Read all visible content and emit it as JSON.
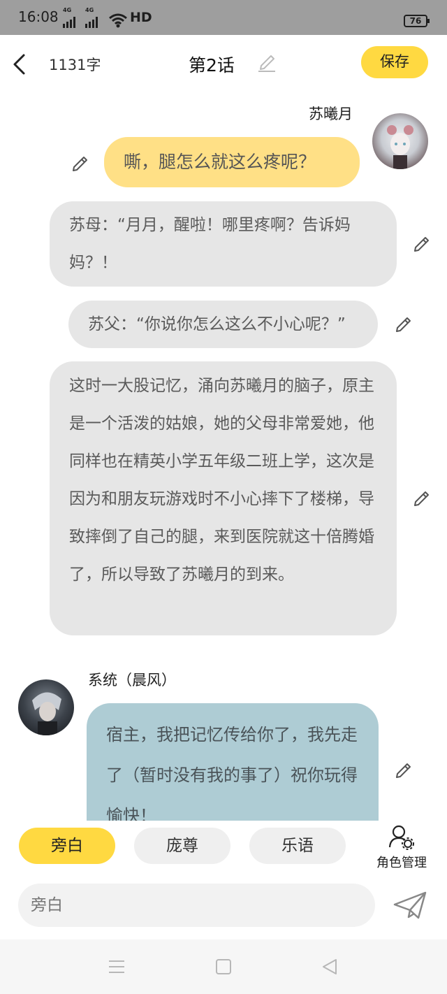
{
  "status_bar": {
    "time": "16:08",
    "signal_1": "4G",
    "signal_2": "4G",
    "hd": "HD",
    "battery": "76"
  },
  "header": {
    "word_count": "1131字",
    "title": "第2话",
    "save_label": "保存"
  },
  "messages": [
    {
      "speaker": "苏曦月",
      "text": "嘶，腿怎么就这么疼呢？"
    },
    {
      "speaker": "",
      "text": "苏母：“月月，醒啦！哪里疼啊？告诉妈妈？！"
    },
    {
      "speaker": "",
      "text": "苏父：“你说你怎么这么不小心呢？”"
    },
    {
      "speaker": "",
      "text": "这时一大股记忆，涌向苏曦月的脑子，原主是一个活泼的姑娘，她的父母非常爱她，他同样也在精英小学五年级二班上学，这次是因为和朋友玩游戏时不小心摔下了楼梯，导致摔倒了自己的腿，来到医院就这十倍腾婚了，所以导致了苏曦月的到来。"
    },
    {
      "speaker": "系统（晨风）",
      "text": "宿主，我把记忆传给你了，我先走了（暂时没有我的事了）祝你玩得愉快！"
    }
  ],
  "roles": [
    {
      "label": "旁白",
      "active": true
    },
    {
      "label": "庞尊",
      "active": false
    },
    {
      "label": "乐语",
      "active": false
    }
  ],
  "role_manager_label": "角色管理",
  "input": {
    "placeholder": "旁白"
  },
  "colors": {
    "accent": "#ffd941",
    "self_bubble": "#ffe086",
    "narration_bubble": "#e6e6e6",
    "system_bubble": "#aeccd4"
  }
}
